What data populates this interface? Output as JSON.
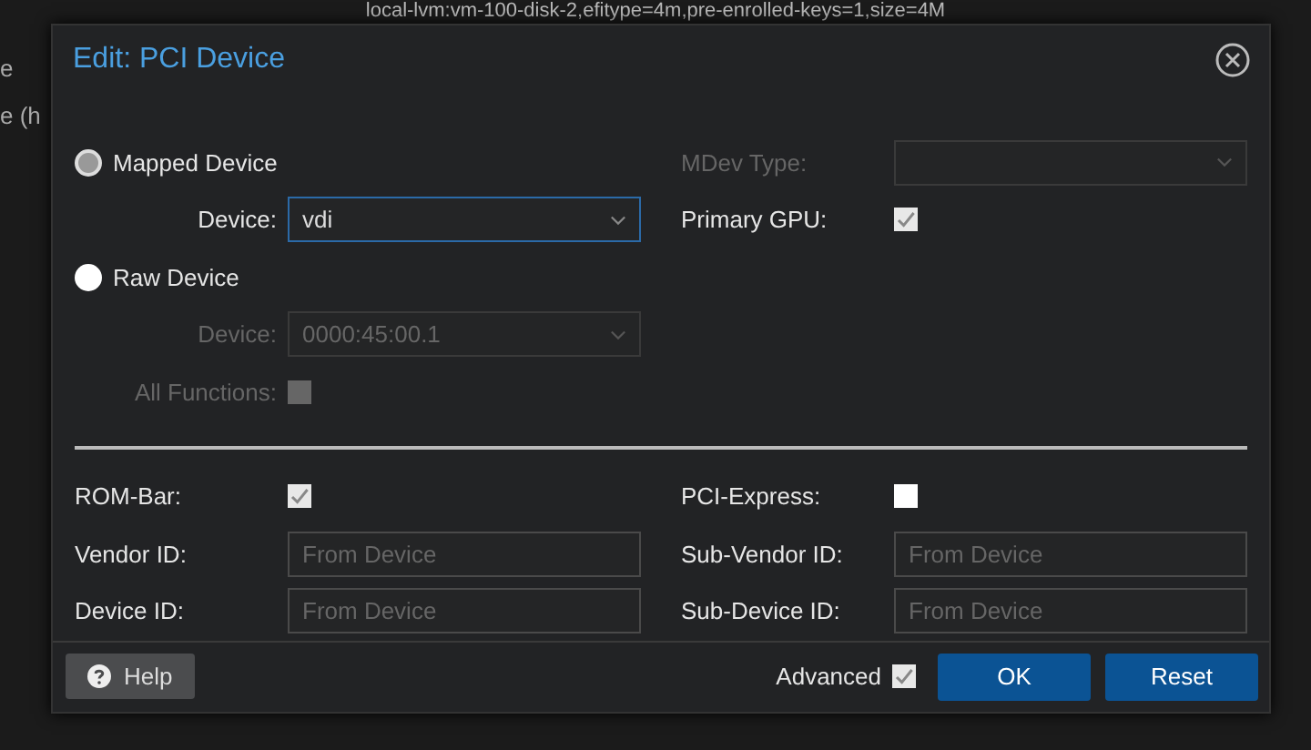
{
  "background": {
    "command_line": "local-lvm:vm-100-disk-2,efitype=4m,pre-enrolled-keys=1,size=4M",
    "fragments": [
      "e",
      "e (h"
    ]
  },
  "dialog": {
    "title": "Edit: PCI Device",
    "left_fields": [
      {
        "kind": "radio",
        "label": "Mapped Device",
        "selected": true
      },
      {
        "kind": "select",
        "label": "Device:",
        "value": "vdi",
        "disabled": false,
        "focused": true
      },
      {
        "kind": "radio",
        "label": "Raw Device",
        "selected": false
      },
      {
        "kind": "select",
        "label": "Device:",
        "value": "0000:45:00.1",
        "disabled": true,
        "focused": false
      },
      {
        "kind": "checkbox",
        "label": "All Functions:",
        "checked": false,
        "disabled": true
      }
    ],
    "right_fields": [
      {
        "kind": "select",
        "label": "MDev Type:",
        "disabled": true,
        "focused": false
      },
      {
        "kind": "checkbox",
        "label": "Primary GPU:",
        "checked": true,
        "disabled": false
      }
    ],
    "advanced_left": [
      {
        "kind": "checkbox",
        "label": "ROM-Bar:",
        "checked": true,
        "disabled": false
      },
      {
        "kind": "text",
        "label": "Vendor ID:",
        "placeholder": "From Device"
      },
      {
        "kind": "text",
        "label": "Device ID:",
        "placeholder": "From Device"
      }
    ],
    "advanced_right": [
      {
        "kind": "checkbox",
        "label": "PCI-Express:",
        "checked": false,
        "disabled": false
      },
      {
        "kind": "text",
        "label": "Sub-Vendor ID:",
        "placeholder": "From Device"
      },
      {
        "kind": "text",
        "label": "Sub-Device ID:",
        "placeholder": "From Device"
      }
    ],
    "footer": {
      "help": "Help",
      "advanced": {
        "label": "Advanced",
        "checked": true
      },
      "buttons": [
        "OK",
        "Reset"
      ]
    }
  }
}
